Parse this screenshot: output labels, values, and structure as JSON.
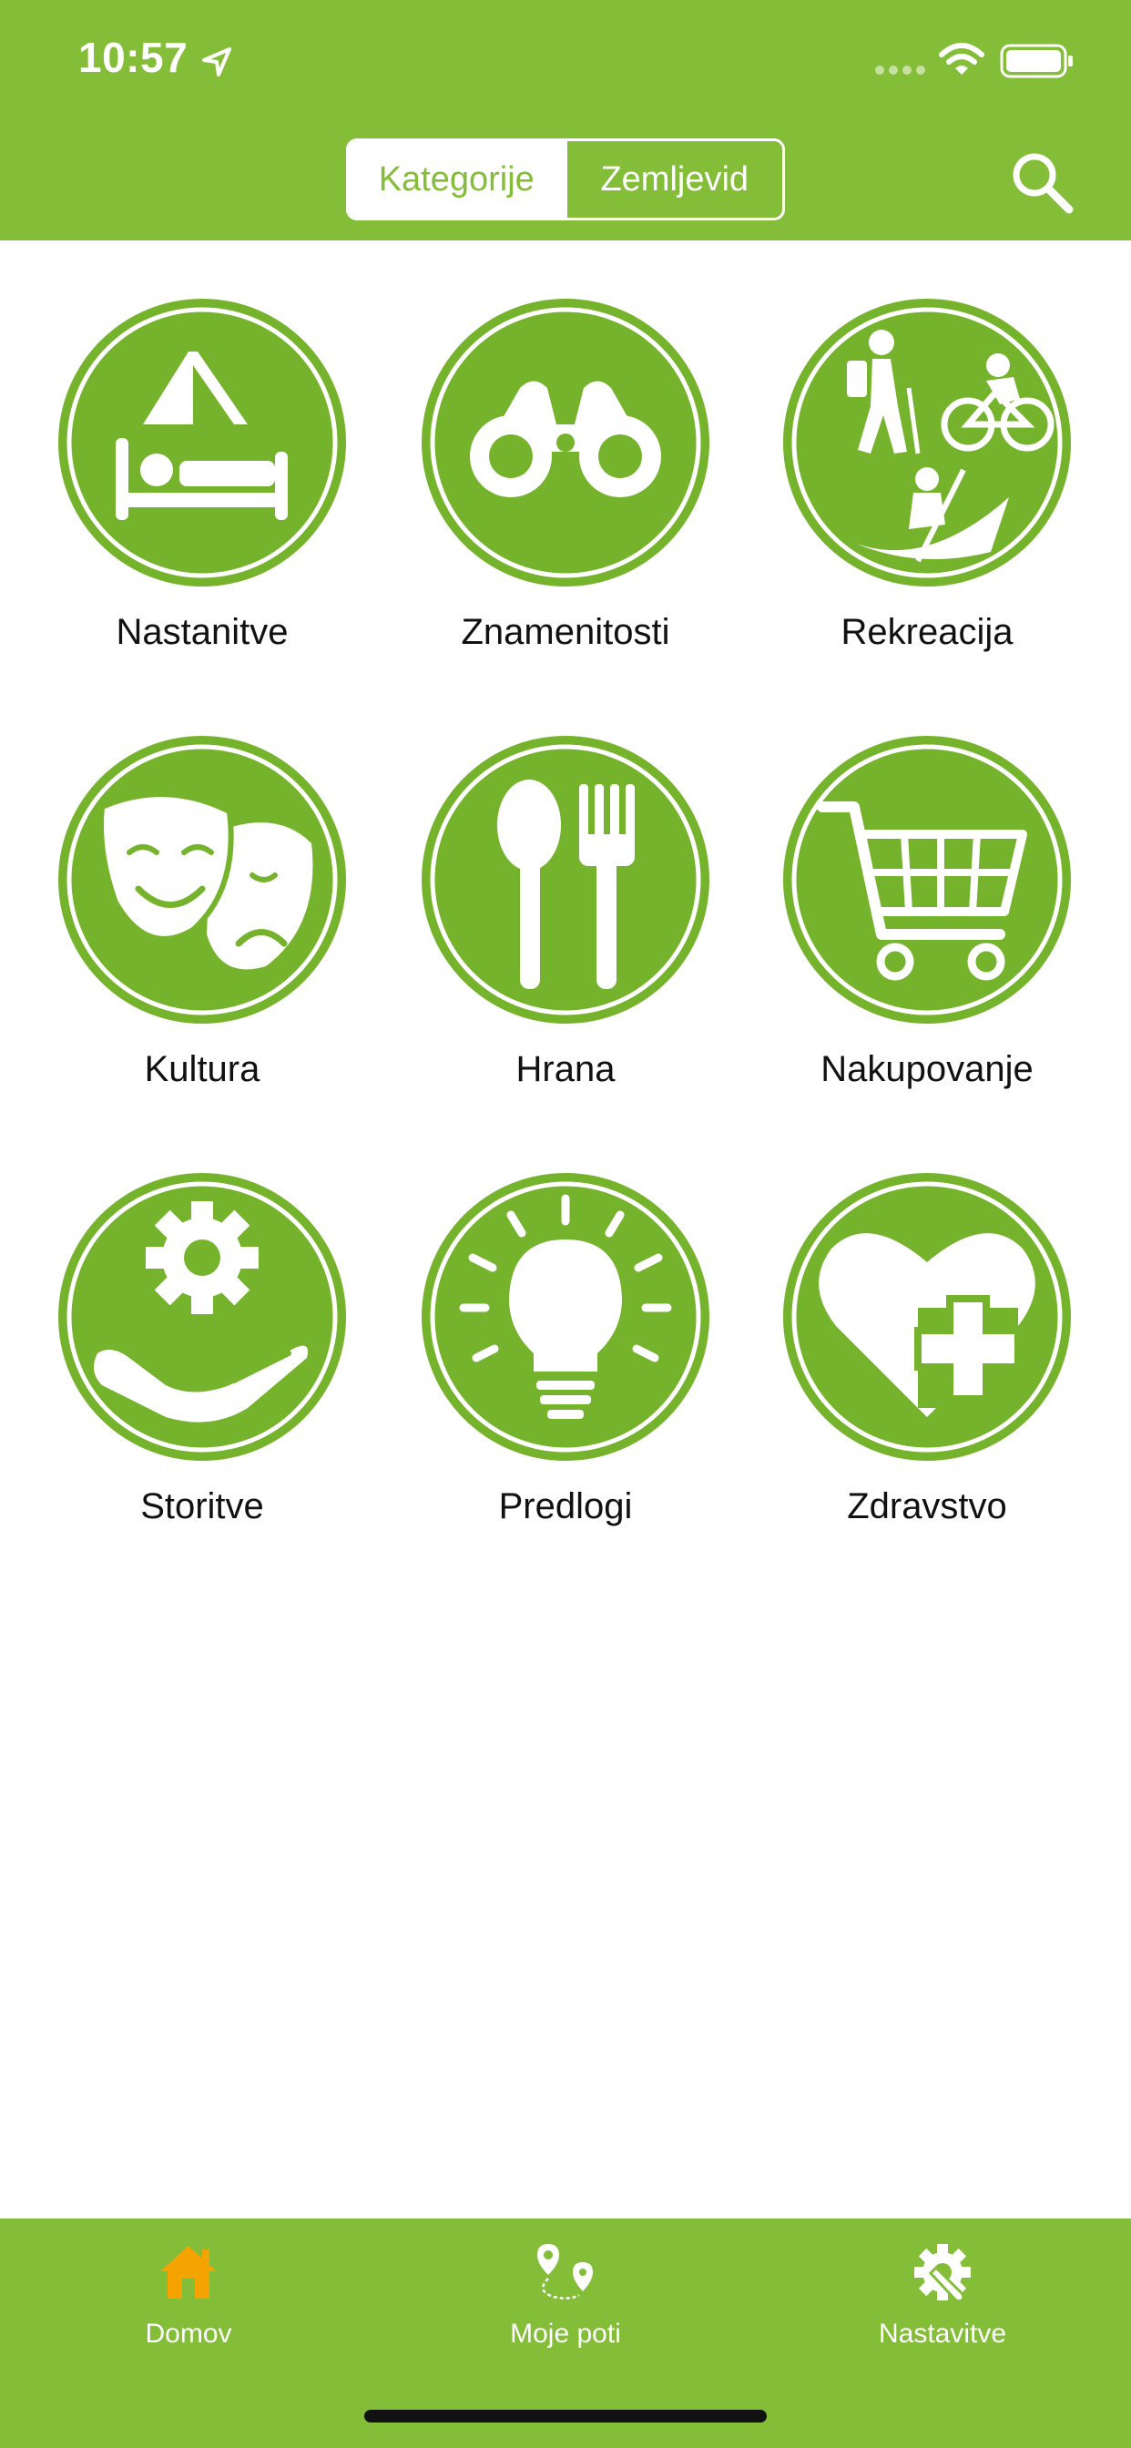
{
  "status_bar": {
    "time": "10:57"
  },
  "header": {
    "segments": [
      {
        "label": "Kategorije",
        "active": true
      },
      {
        "label": "Zemljevid",
        "active": false
      }
    ],
    "search_icon": "search-icon"
  },
  "categories": [
    {
      "label": "Nastanitve",
      "icon": "tent-bed-icon"
    },
    {
      "label": "Znamenitosti",
      "icon": "binoculars-icon"
    },
    {
      "label": "Rekreacija",
      "icon": "hiking-cycling-kayak-icon"
    },
    {
      "label": "Kultura",
      "icon": "theater-masks-icon"
    },
    {
      "label": "Hrana",
      "icon": "spoon-fork-icon"
    },
    {
      "label": "Nakupovanje",
      "icon": "shopping-cart-icon"
    },
    {
      "label": "Storitve",
      "icon": "gear-hand-icon"
    },
    {
      "label": "Predlogi",
      "icon": "lightbulb-icon"
    },
    {
      "label": "Zdravstvo",
      "icon": "heart-plus-icon"
    }
  ],
  "tabbar": {
    "items": [
      {
        "label": "Domov",
        "icon": "home-icon",
        "active": true
      },
      {
        "label": "Moje poti",
        "icon": "route-pins-icon",
        "active": false
      },
      {
        "label": "Nastavitve",
        "icon": "gear-wrench-icon",
        "active": false
      }
    ]
  },
  "colors": {
    "brand_green": "#84bd37",
    "badge_green": "#76b32c",
    "active_tab": "#f5a300"
  }
}
